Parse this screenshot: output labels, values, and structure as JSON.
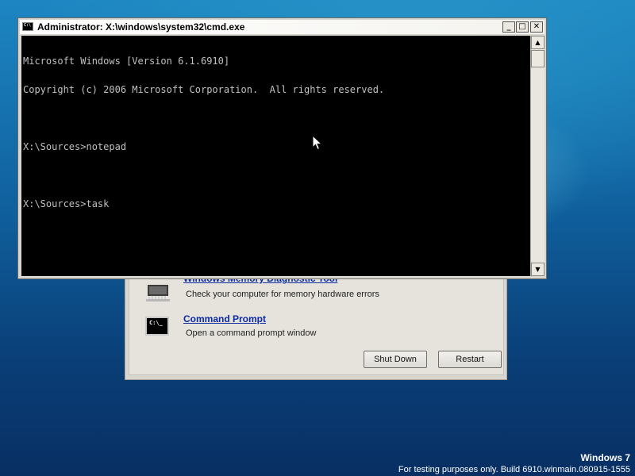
{
  "cmd_window": {
    "title": "Administrator: X:\\windows\\system32\\cmd.exe",
    "icon_text": "C:\\",
    "lines": [
      "Microsoft Windows [Version 6.1.6910]",
      "Copyright (c) 2006 Microsoft Corporation.  All rights reserved.",
      "",
      "X:\\Sources>notepad",
      "",
      "X:\\Sources>task"
    ]
  },
  "recovery_dialog": {
    "tools": [
      {
        "name": "Windows Memory Diagnostic Tool",
        "description": "Check your computer for memory hardware errors",
        "icon": "memory-chip-icon"
      },
      {
        "name": "Command Prompt",
        "description": "Open a command prompt window",
        "icon": "command-prompt-icon",
        "icon_text": "C:\\_"
      }
    ],
    "buttons": {
      "shutdown": "Shut Down",
      "restart": "Restart"
    }
  },
  "watermark": {
    "brand": "Windows 7",
    "build": "For testing purposes only. Build 6910.winmain.080915-1555"
  },
  "colors": {
    "link": "#0c2aa2",
    "console_bg": "#000000",
    "console_text": "#c0c0c0"
  }
}
